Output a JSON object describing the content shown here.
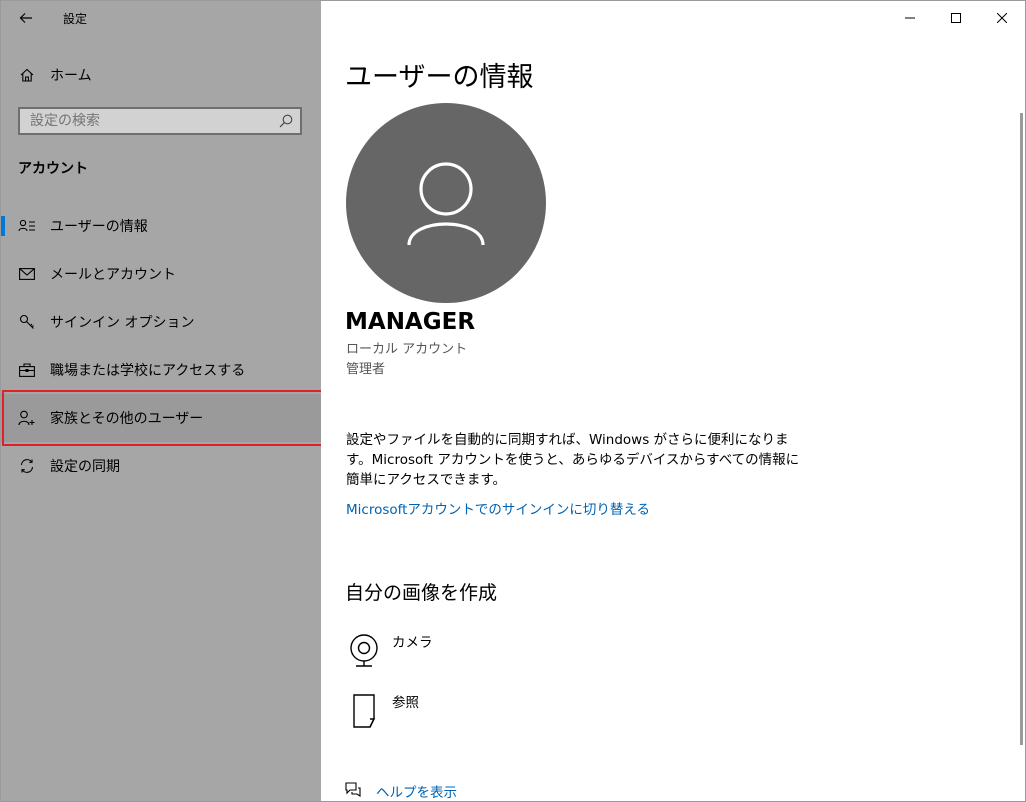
{
  "window": {
    "title": "設定"
  },
  "sidebar": {
    "home_label": "ホーム",
    "search_placeholder": "設定の検索",
    "section_title": "アカウント",
    "items": [
      {
        "label": "ユーザーの情報",
        "icon": "user-info-icon",
        "selected": true
      },
      {
        "label": "メールとアカウント",
        "icon": "mail-icon"
      },
      {
        "label": "サインイン オプション",
        "icon": "key-icon"
      },
      {
        "label": "職場または学校にアクセスする",
        "icon": "briefcase-icon"
      },
      {
        "label": "家族とその他のユーザー",
        "icon": "add-user-icon",
        "highlighted": true
      },
      {
        "label": "設定の同期",
        "icon": "sync-icon"
      }
    ]
  },
  "main": {
    "page_title": "ユーザーの情報",
    "user": {
      "name": "MANAGER",
      "account_type": "ローカル アカウント",
      "role": "管理者"
    },
    "sync_description": "設定やファイルを自動的に同期すれば、Windows がさらに便利になります。Microsoft アカウントを使うと、あらゆるデバイスからすべての情報に簡単にアクセスできます。",
    "ms_link": "Microsoftアカウントでのサインインに切り替える",
    "picture_section_title": "自分の画像を作成",
    "picture_options": [
      {
        "label": "カメラ",
        "icon": "camera-icon"
      },
      {
        "label": "参照",
        "icon": "browse-icon"
      }
    ],
    "help_link": "ヘルプを表示"
  },
  "colors": {
    "sidebar_bg": "#a6a6a6",
    "accent": "#0078d7",
    "link": "#0063b1",
    "avatar_bg": "#666666",
    "highlight_border": "#e0202a"
  }
}
